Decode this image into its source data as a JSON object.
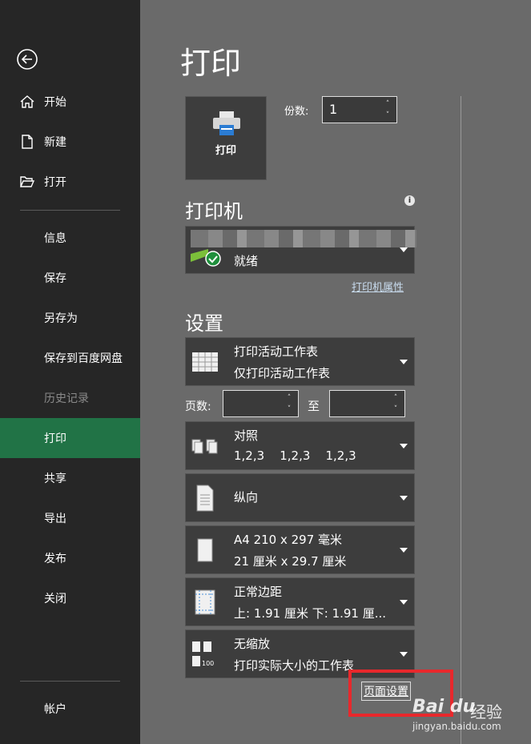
{
  "sidebar": {
    "items": [
      {
        "label": "开始"
      },
      {
        "label": "新建"
      },
      {
        "label": "打开"
      },
      {
        "label": "信息"
      },
      {
        "label": "保存"
      },
      {
        "label": "另存为"
      },
      {
        "label": "保存到百度网盘"
      },
      {
        "label": "历史记录"
      },
      {
        "label": "打印"
      },
      {
        "label": "共享"
      },
      {
        "label": "导出"
      },
      {
        "label": "发布"
      },
      {
        "label": "关闭"
      },
      {
        "label": "帐户"
      }
    ]
  },
  "main": {
    "title": "打印",
    "print_button": "打印",
    "copies_label": "份数:",
    "copies_value": "1",
    "printer_heading": "打印机",
    "printer_status": "就绪",
    "printer_properties": "打印机属性",
    "settings_heading": "设置",
    "pages_label": "页数:",
    "to_label": "至",
    "settings": [
      {
        "line1": "打印活动工作表",
        "line2": "仅打印活动工作表"
      },
      {
        "line1": "对照",
        "line2": "1,2,3    1,2,3    1,2,3"
      },
      {
        "line1": "纵向"
      },
      {
        "line1": "A4 210 x 297 毫米",
        "line2": "21 厘米 x 29.7 厘米"
      },
      {
        "line1": "正常边距",
        "line2": "上: 1.91 厘米 下: 1.91 厘..."
      },
      {
        "line1": "无缩放",
        "line2": "打印实际大小的工作表"
      }
    ],
    "page_setup_link": "页面设置"
  },
  "watermark": {
    "logo": "Bai du",
    "cn": "经验",
    "url": "jingyan.baidu.com"
  }
}
